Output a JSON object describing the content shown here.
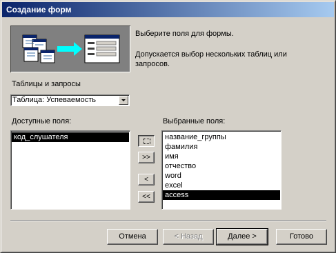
{
  "window": {
    "title": "Создание форм"
  },
  "intro": {
    "line1": "Выберите поля для формы.",
    "line2": "Допускается выбор нескольких таблиц или",
    "line3": "запросов."
  },
  "source": {
    "label": "Таблицы и запросы",
    "selected": "Таблица: Успеваемость"
  },
  "available": {
    "label": "Доступные поля:",
    "items": [
      "код_слушателя"
    ],
    "selected_index": 0
  },
  "chosen": {
    "label": "Выбранные поля:",
    "items": [
      "название_группы",
      "фамилия",
      "имя",
      "отчество",
      "word",
      "excel",
      "access"
    ],
    "selected_index": 6
  },
  "move_buttons": {
    "add_all": ">>",
    "remove_one": "<",
    "remove_all": "<<"
  },
  "footer": {
    "cancel": "Отмена",
    "back": "< Назад",
    "next": "Далее >",
    "finish": "Готово"
  }
}
